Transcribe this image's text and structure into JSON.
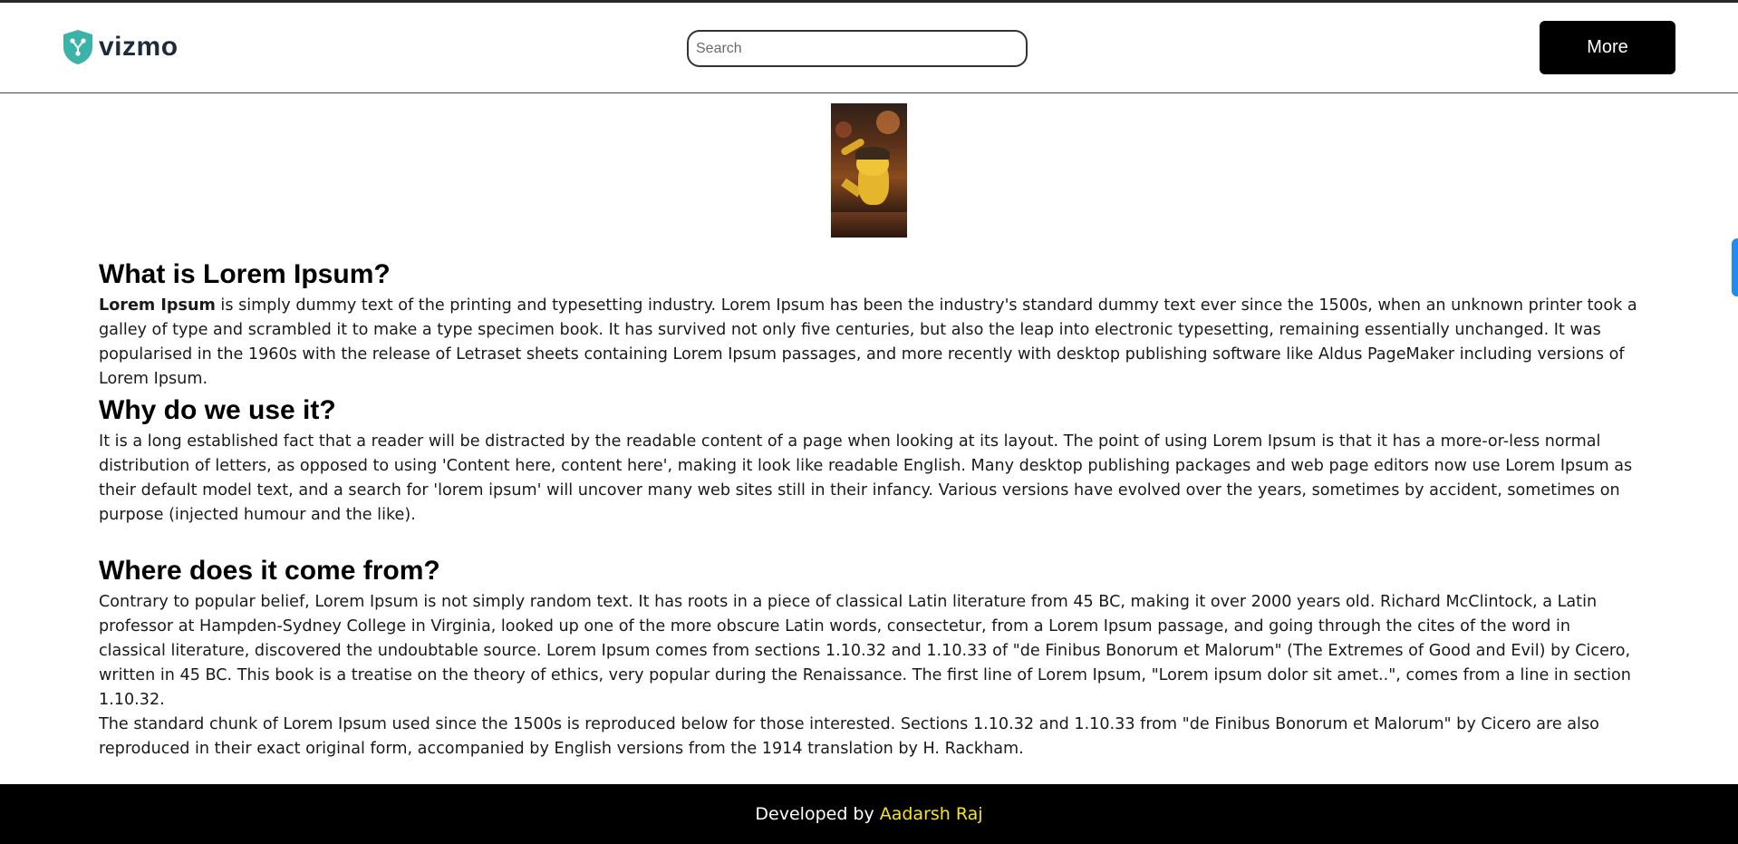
{
  "header": {
    "brand": "vizmo",
    "brand_color": "#3bb3a8",
    "search_placeholder": "Search",
    "more_label": "More"
  },
  "hero_image": {
    "icon": "pikachu-detective-photo"
  },
  "sections": [
    {
      "heading": "What is Lorem Ipsum?",
      "lead_bold": "Lorem Ipsum",
      "text": " is simply dummy text of the printing and typesetting industry. Lorem Ipsum has been the industry's standard dummy text ever since the 1500s, when an unknown printer took a galley of type and scrambled it to make a type specimen book. It has survived not only five centuries, but also the leap into electronic typesetting, remaining essentially unchanged. It was popularised in the 1960s with the release of Letraset sheets containing Lorem Ipsum passages, and more recently with desktop publishing software like Aldus PageMaker including versions of Lorem Ipsum."
    },
    {
      "heading": "Why do we use it?",
      "text": "It is a long established fact that a reader will be distracted by the readable content of a page when looking at its layout. The point of using Lorem Ipsum is that it has a more-or-less normal distribution of letters, as opposed to using 'Content here, content here', making it look like readable English. Many desktop publishing packages and web page editors now use Lorem Ipsum as their default model text, and a search for 'lorem ipsum' will uncover many web sites still in their infancy. Various versions have evolved over the years, sometimes by accident, sometimes on purpose (injected humour and the like)."
    },
    {
      "heading": "Where does it come from?",
      "text": "Contrary to popular belief, Lorem Ipsum is not simply random text. It has roots in a piece of classical Latin literature from 45 BC, making it over 2000 years old. Richard McClintock, a Latin professor at Hampden-Sydney College in Virginia, looked up one of the more obscure Latin words, consectetur, from a Lorem Ipsum passage, and going through the cites of the word in classical literature, discovered the undoubtable source. Lorem Ipsum comes from sections 1.10.32 and 1.10.33 of \"de Finibus Bonorum et Malorum\" (The Extremes of Good and Evil) by Cicero, written in 45 BC. This book is a treatise on the theory of ethics, very popular during the Renaissance. The first line of Lorem Ipsum, \"Lorem ipsum dolor sit amet..\", comes from a line in section 1.10.32.",
      "text2": "The standard chunk of Lorem Ipsum used since the 1500s is reproduced below for those interested. Sections 1.10.32 and 1.10.33 from \"de Finibus Bonorum et Malorum\" by Cicero are also reproduced in their exact original form, accompanied by English versions from the 1914 translation by H. Rackham."
    }
  ],
  "footer": {
    "prefix": "Developed by",
    "author": "Aadarsh Raj",
    "author_color": "#f5e41b"
  }
}
